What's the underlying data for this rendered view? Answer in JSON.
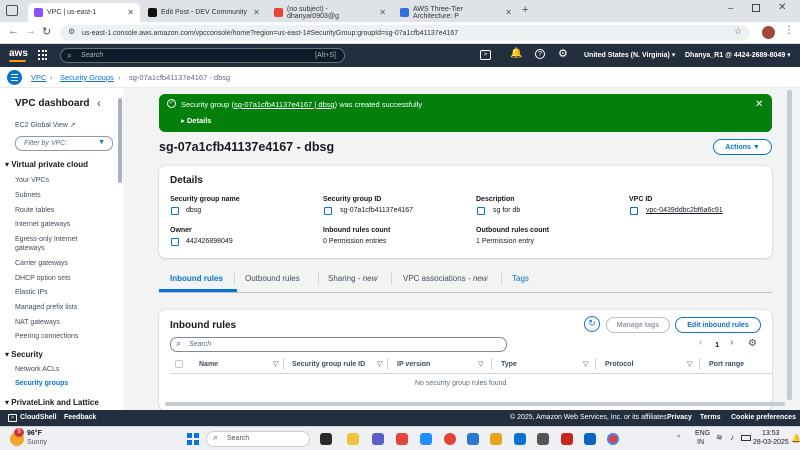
{
  "browser": {
    "tabs": [
      {
        "title": "VPC | us-east-1",
        "color": "#8c4fff"
      },
      {
        "title": "Edit Post - DEV Community",
        "color": "#111111"
      },
      {
        "title": "(no subject) - dhanyar0903@g",
        "color": "#ea4335"
      },
      {
        "title": "AWS Three-Tier Architecture: P",
        "color": "#2f6fde"
      }
    ],
    "url": "us-east-1.console.aws.amazon.com/vpcconsole/home?region=us-east-1#SecurityGroup:groupId=sg-07a1cfb41137e4167"
  },
  "aws_nav": {
    "logo": "aws",
    "search_placeholder": "Search",
    "search_shortcut": "[Alt+S]",
    "region": "United States (N. Virginia)",
    "account": "Dhanya_R1 @ 4424-2689-8049"
  },
  "breadcrumb": {
    "vpc": "VPC",
    "security_groups": "Security Groups",
    "current": "sg-07a1cfb41137e4167 - dbsg"
  },
  "sidebar": {
    "title": "VPC dashboard",
    "ec2_global_view": "EC2 Global View",
    "filter_placeholder": "Filter by VPC:",
    "section_vpc": "Virtual private cloud",
    "vpc_items": [
      "Your VPCs",
      "Subnets",
      "Route tables",
      "Internet gateways",
      "Egress-only Internet",
      "gateways",
      "Carrier gateways",
      "DHCP option sets",
      "Elastic IPs",
      "Managed prefix lists",
      "NAT gateways",
      "Peering connections"
    ],
    "section_security": "Security",
    "security_items": [
      "Network ACLs",
      "Security groups"
    ],
    "section_privatelink": "PrivateLink and Lattice"
  },
  "flash": {
    "prefix": "Security group (",
    "link": "sg-07a1cfb41137e4167 | dbsg",
    "suffix": ") was created successfully",
    "details": "Details"
  },
  "page": {
    "title": "sg-07a1cfb41137e4167 - dbsg",
    "actions": "Actions"
  },
  "details": {
    "heading": "Details",
    "sg_name_label": "Security group name",
    "sg_name": "dbsg",
    "sg_id_label": "Security group ID",
    "sg_id": "sg-07a1cfb41137e4167",
    "desc_label": "Description",
    "desc": "sg for db",
    "vpc_label": "VPC ID",
    "vpc": "vpc-0439ddbc2bf6a6c91",
    "owner_label": "Owner",
    "owner": "442426898049",
    "inbound_count_label": "Inbound rules count",
    "inbound_count": "0 Permission entries",
    "outbound_count_label": "Outbound rules count",
    "outbound_count": "1 Permission entry"
  },
  "tabs": [
    {
      "label": "Inbound rules",
      "active": true
    },
    {
      "label": "Outbound rules"
    },
    {
      "label": "Sharing - ",
      "suffix": "new"
    },
    {
      "label": "VPC associations - ",
      "suffix": "new"
    },
    {
      "label": "Tags"
    }
  ],
  "inbound": {
    "heading": "Inbound rules",
    "manage_tags": "Manage tags",
    "edit": "Edit inbound rules",
    "search_placeholder": "Search",
    "page": "1",
    "columns": [
      "Name",
      "Security group rule ID",
      "IP version",
      "Type",
      "Protocol",
      "Port range"
    ],
    "empty": "No security group rules found"
  },
  "footer": {
    "cloudshell": "CloudShell",
    "feedback": "Feedback",
    "copyright": "© 2025, Amazon Web Services, Inc. or its affiliates.",
    "privacy": "Privacy",
    "terms": "Terms",
    "cookies": "Cookie preferences"
  },
  "taskbar": {
    "weather_temp": "96°F",
    "weather_desc": "Sunny",
    "search": "Search",
    "lang": "ENG",
    "region": "IN",
    "time": "13:53",
    "date": "28-03-2025",
    "badge": "9"
  }
}
